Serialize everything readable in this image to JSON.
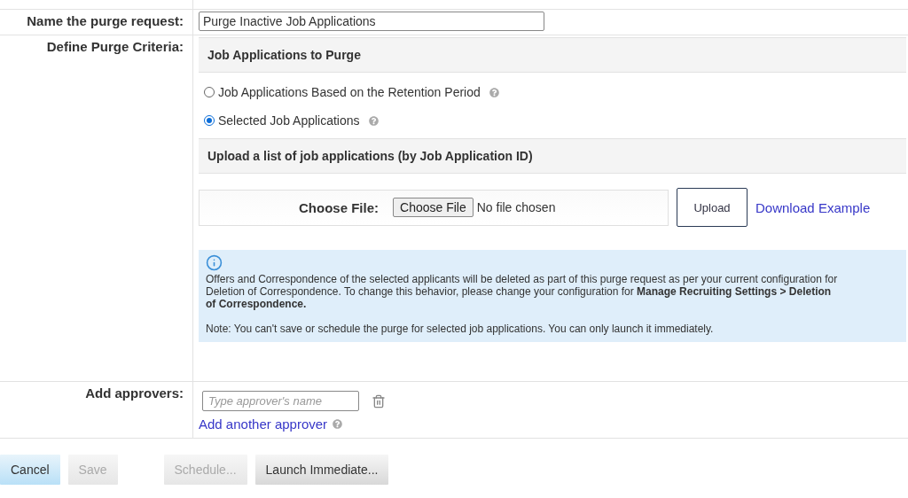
{
  "name_request": {
    "label": "Name the purge request:",
    "value": "Purge Inactive Job Applications"
  },
  "criteria": {
    "label": "Define Purge Criteria:",
    "section_title": "Job Applications to Purge",
    "options": [
      {
        "label": "Job Applications Based on the Retention Period",
        "selected": false
      },
      {
        "label": "Selected Job Applications",
        "selected": true
      }
    ],
    "upload_title": "Upload a list of job applications (by Job Application ID)",
    "choose_label": "Choose File:",
    "choose_button": "Choose File",
    "file_status": "No file chosen",
    "upload_button": "Upload",
    "download_link": "Download Example",
    "info": {
      "text": "Offers and Correspondence of the selected applicants will be deleted as part of this purge request as per your current configuration for Deletion of Correspondence. To change this behavior, please change your configuration for **Manage Recruiting Settings > Deletion of Correspondence.**",
      "note": "Note: You can't save or schedule the purge for selected job applications. You can only launch it immediately."
    }
  },
  "approvers": {
    "label": "Add approvers:",
    "placeholder": "Type approver's name",
    "add_link": "Add another approver"
  },
  "left_buttons": [
    {
      "label": "Cancel",
      "primary": true,
      "disabled": false
    },
    {
      "label": "Save",
      "primary": false,
      "disabled": true
    }
  ],
  "right_buttons": [
    {
      "label": "Schedule...",
      "primary": false,
      "disabled": true
    },
    {
      "label": "Launch Immediate...",
      "primary": false,
      "disabled": false
    }
  ]
}
